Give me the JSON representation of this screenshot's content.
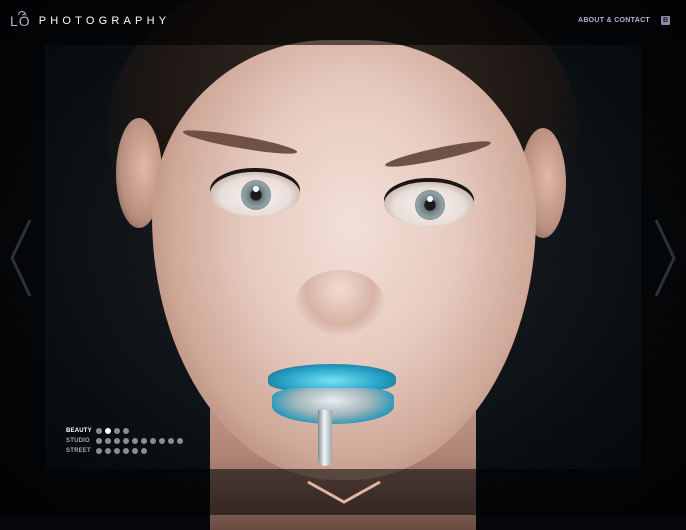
{
  "header": {
    "logo_mark": "LÔ",
    "logo_text": "PHOTOGRAPHY",
    "about_contact": "ABOUT & CONTACT",
    "social_label": "B"
  },
  "categories": [
    {
      "label": "BEAUTY",
      "active": true,
      "dots": 4,
      "active_dot": 1
    },
    {
      "label": "STUDIO",
      "active": false,
      "dots": 10,
      "active_dot": -1
    },
    {
      "label": "STREET",
      "active": false,
      "dots": 6,
      "active_dot": -1
    }
  ],
  "icons": {
    "prev": "chevron-left-icon",
    "next": "chevron-right-icon",
    "down": "chevron-down-icon"
  },
  "colors": {
    "accent": "#b9b2d4",
    "down_arrow": "#e2b59f",
    "side_arrow": "#2c3038"
  }
}
